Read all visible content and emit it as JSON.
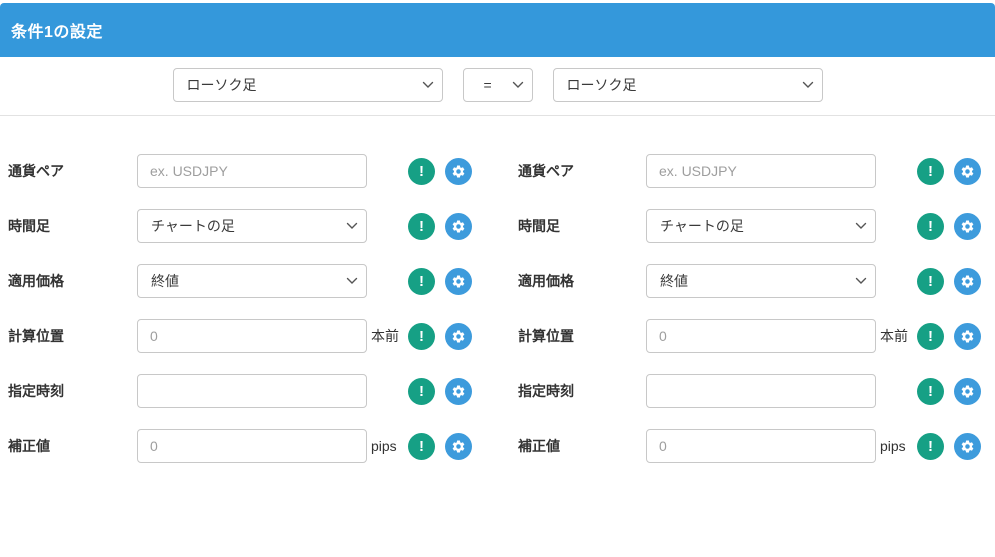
{
  "header": {
    "title": "条件1の設定"
  },
  "colors": {
    "header_bg": "#3498db",
    "alert_green": "#16a085",
    "gear_blue": "#3d9bdc"
  },
  "comparison": {
    "left_operand": {
      "value": "ローソク足"
    },
    "operator": {
      "value": "="
    },
    "right_operand": {
      "value": "ローソク足"
    }
  },
  "icons": {
    "alert": "!"
  },
  "form": {
    "left": {
      "rows": [
        {
          "label": "通貨ペア",
          "control": "text",
          "placeholder": "ex. USDJPY",
          "value": "",
          "suffix": ""
        },
        {
          "label": "時間足",
          "control": "select",
          "value": "チャートの足",
          "suffix": ""
        },
        {
          "label": "適用価格",
          "control": "select",
          "value": "終値",
          "suffix": ""
        },
        {
          "label": "計算位置",
          "control": "text",
          "placeholder": "0",
          "value": "",
          "suffix": "本前"
        },
        {
          "label": "指定時刻",
          "control": "text",
          "placeholder": "",
          "value": "",
          "suffix": ""
        },
        {
          "label": "補正値",
          "control": "text",
          "placeholder": "0",
          "value": "",
          "suffix": "pips"
        }
      ]
    },
    "right": {
      "rows": [
        {
          "label": "通貨ペア",
          "control": "text",
          "placeholder": "ex. USDJPY",
          "value": "",
          "suffix": ""
        },
        {
          "label": "時間足",
          "control": "select",
          "value": "チャートの足",
          "suffix": ""
        },
        {
          "label": "適用価格",
          "control": "select",
          "value": "終値",
          "suffix": ""
        },
        {
          "label": "計算位置",
          "control": "text",
          "placeholder": "0",
          "value": "",
          "suffix": "本前"
        },
        {
          "label": "指定時刻",
          "control": "text",
          "placeholder": "",
          "value": "",
          "suffix": ""
        },
        {
          "label": "補正値",
          "control": "text",
          "placeholder": "0",
          "value": "",
          "suffix": "pips"
        }
      ]
    }
  }
}
